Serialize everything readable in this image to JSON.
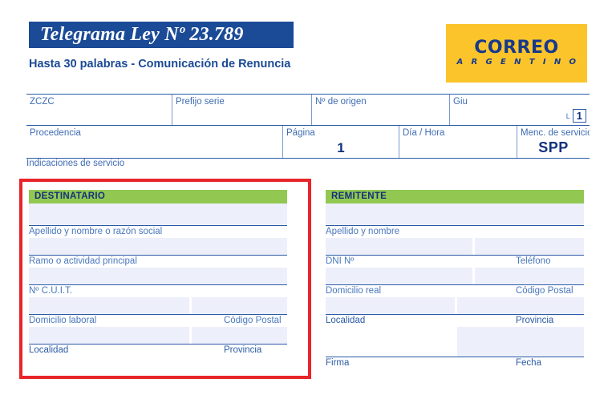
{
  "header": {
    "title": "Telegrama Ley Nº 23.789",
    "subtitle": "Hasta 30 palabras  -  Comunicación de Renuncia",
    "logo": {
      "primary": "CORREO",
      "secondary": "A R G E N T I N O"
    }
  },
  "colors": {
    "title_blue": "#1b4a96",
    "label_blue": "#4a78bd",
    "rule_blue": "#2c5ba6",
    "section_green": "#92c851",
    "logo_yellow": "#fbc42a",
    "field_fill": "#edf0fb",
    "highlight_red": "#e8252a"
  },
  "top_grid": {
    "row1": [
      {
        "label": "ZCZC",
        "value": ""
      },
      {
        "label": "Prefijo serie",
        "value": ""
      },
      {
        "label": "Nº de origen",
        "value": ""
      },
      {
        "label": "Giu",
        "value": "",
        "suffix_label": "L",
        "suffix_box": "1"
      }
    ],
    "row2": [
      {
        "label": "Procedencia",
        "value": ""
      },
      {
        "label": "Página",
        "value": "1"
      },
      {
        "label": "Día / Hora",
        "value": ""
      },
      {
        "label": "Menc. de servicio",
        "value": "SPP"
      }
    ],
    "footer_label": "Indicaciones de servicio"
  },
  "destinatario": {
    "heading": "DESTINATARIO",
    "fields": [
      {
        "label": "Apellido y nombre o razón social",
        "value": ""
      },
      {
        "label": "Ramo o actividad principal",
        "value": ""
      },
      {
        "label": "Nº C.U.I.T.",
        "value": ""
      },
      {
        "label": "Domicilio laboral",
        "value": ""
      },
      {
        "label": "Código Postal",
        "value": ""
      },
      {
        "label": "Localidad",
        "value": ""
      },
      {
        "label": "Provincia",
        "value": ""
      }
    ]
  },
  "remitente": {
    "heading": "REMITENTE",
    "fields": [
      {
        "label": "Apellido y nombre",
        "value": ""
      },
      {
        "label": "DNI Nº",
        "value": ""
      },
      {
        "label": "Teléfono",
        "value": ""
      },
      {
        "label": "Domicilio real",
        "value": ""
      },
      {
        "label": "Código Postal",
        "value": ""
      },
      {
        "label": "Localidad",
        "value": ""
      },
      {
        "label": "Provincia",
        "value": ""
      },
      {
        "label": "Firma",
        "value": ""
      },
      {
        "label": "Fecha",
        "value": ""
      }
    ]
  },
  "annotation": {
    "highlight_target": "DESTINATARIO"
  }
}
